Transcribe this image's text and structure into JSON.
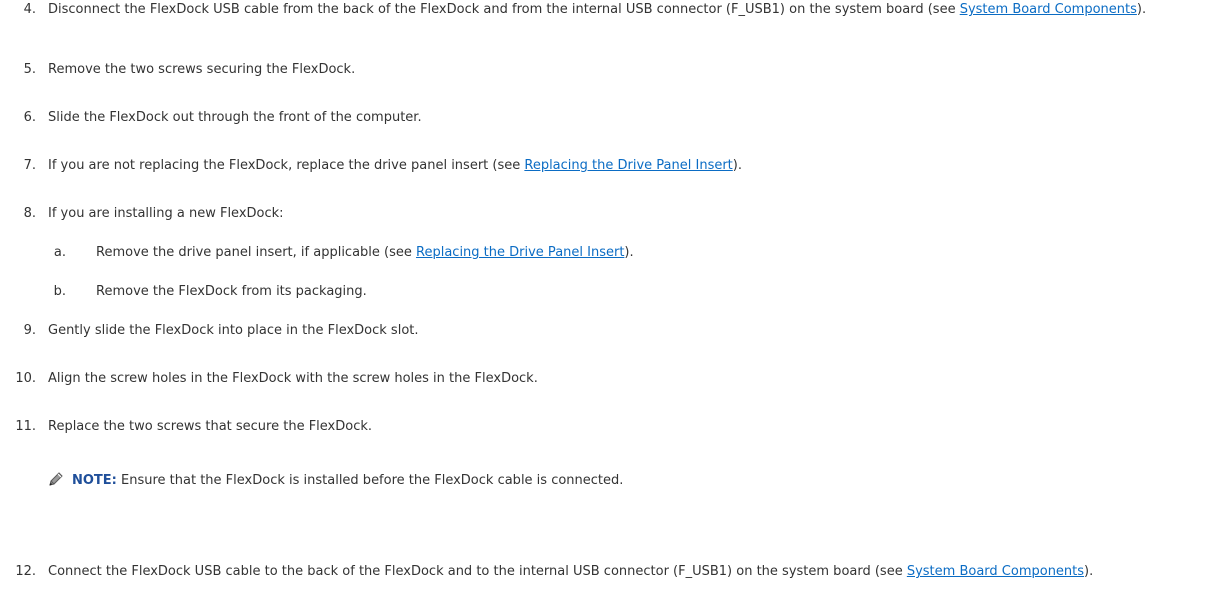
{
  "steps": [
    {
      "num": "4.",
      "before": "Disconnect the FlexDock USB cable from the back of the FlexDock and from the internal USB connector (F_USB1) on the system board (see ",
      "link": "System Board Components",
      "after": ")."
    },
    {
      "num": "5.",
      "text": "Remove the two screws securing the FlexDock."
    },
    {
      "num": "6.",
      "text": "Slide the FlexDock out through the front of the computer."
    },
    {
      "num": "7.",
      "before": "If you are not replacing the FlexDock, replace the drive panel insert (see ",
      "link": "Replacing the Drive Panel Insert",
      "after": ")."
    },
    {
      "num": "8.",
      "text": "If you are installing a new FlexDock:"
    },
    {
      "num": "a.",
      "before": "Remove the drive panel insert, if applicable (see ",
      "link": "Replacing the Drive Panel Insert",
      "after": ")."
    },
    {
      "num": "b.",
      "text": "Remove the FlexDock from its packaging."
    },
    {
      "num": "9.",
      "text": "Gently slide the FlexDock into place in the FlexDock slot."
    },
    {
      "num": "10.",
      "text": "Align the screw holes in the FlexDock with the screw holes in the FlexDock."
    },
    {
      "num": "11.",
      "text": "Replace the two screws that secure the FlexDock."
    },
    {
      "num": "12.",
      "before": "Connect the FlexDock USB cable to the back of the FlexDock and to the internal USB connector (F_USB1) on the system board (see ",
      "link": "System Board Components",
      "after": ")."
    }
  ],
  "note": {
    "icon": "pencil-note-icon",
    "label": "NOTE:",
    "text": " Ensure that the FlexDock is installed before the FlexDock cable is connected."
  },
  "colors": {
    "text": "#333333",
    "link": "#0b6cc4",
    "note_label": "#1f4f9a"
  }
}
